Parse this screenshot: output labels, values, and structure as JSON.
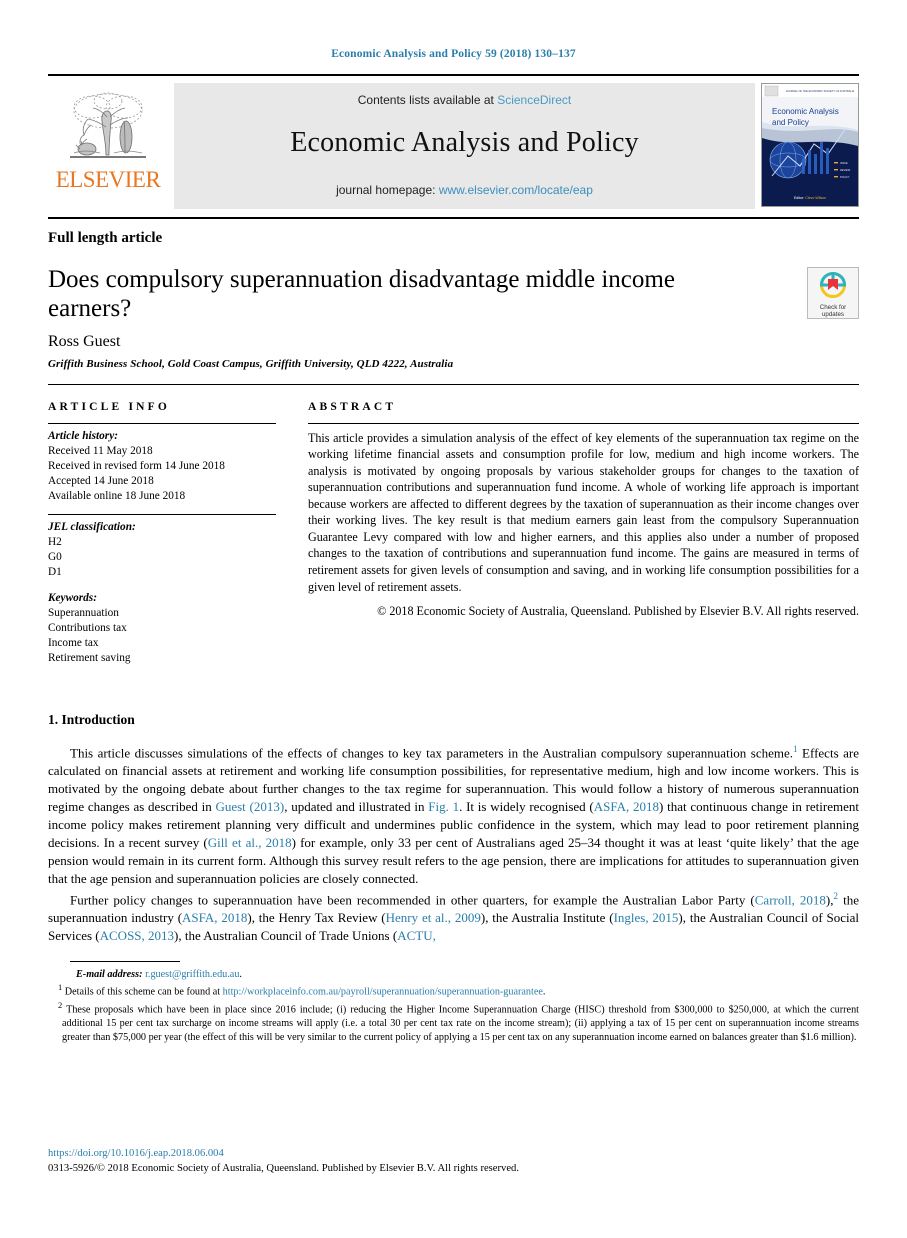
{
  "running_head": "Economic Analysis and Policy 59 (2018) 130–137",
  "masthead": {
    "publisher_name": "ELSEVIER",
    "contents_prefix": "Contents lists available at",
    "contents_link": "ScienceDirect",
    "journal_title": "Economic Analysis and Policy",
    "homepage_prefix": "journal homepage:",
    "homepage_url": "www.elsevier.com/locate/eap",
    "cover_title_line1": "Economic Analysis",
    "cover_title_line2": "and Policy",
    "cover_banner": "JOURNAL OF THE ECONOMIC SOCIETY OF AUSTRALIA (QUEENSLAND)",
    "cover_editor": "Editor: Clevo Wilson"
  },
  "article": {
    "type": "Full length article",
    "title": "Does compulsory superannuation disadvantage middle income earners?",
    "authors": "Ross Guest",
    "affiliation": "Griffith Business School, Gold Coast Campus, Griffith University, QLD 4222, Australia",
    "crossmark_line1": "Check for",
    "crossmark_line2": "updates"
  },
  "article_info": {
    "heading": "ARTICLE INFO",
    "history_label": "Article history:",
    "history": [
      "Received 11 May 2018",
      "Received in revised form 14 June 2018",
      "Accepted 14 June 2018",
      "Available online 18 June 2018"
    ],
    "jel_label": "JEL classification:",
    "jel": [
      "H2",
      "G0",
      "D1"
    ],
    "keywords_label": "Keywords:",
    "keywords": [
      "Superannuation",
      "Contributions tax",
      "Income tax",
      "Retirement saving"
    ]
  },
  "abstract": {
    "heading": "ABSTRACT",
    "text": "This article provides a simulation analysis of the effect of key elements of the superannuation tax regime on the working lifetime financial assets and consumption profile for low, medium and high income workers. The analysis is motivated by ongoing proposals by various stakeholder groups for changes to the taxation of superannuation contributions and superannuation fund income. A whole of working life approach is important because workers are affected to different degrees by the taxation of superannuation as their income changes over their working lives. The key result is that medium earners gain least from the compulsory Superannuation Guarantee Levy compared with low and higher earners, and this applies also under a number of proposed changes to the taxation of contributions and superannuation fund income. The gains are measured in terms of retirement assets for given levels of consumption and saving, and in working life consumption possibilities for a given level of retirement assets.",
    "copyright": "© 2018 Economic Society of Australia, Queensland. Published by Elsevier B.V. All rights reserved."
  },
  "intro": {
    "heading": "1. Introduction",
    "p1_a": "This article discusses simulations of the effects of changes to key tax parameters in the Australian compulsory superannuation scheme.",
    "p1_fn": "1",
    "p1_b": " Effects are calculated on financial assets at retirement and working life consumption possibilities, for representative medium, high and low income workers. This is motivated by the ongoing debate about further changes to the tax regime for superannuation. This would follow a history of numerous superannuation regime changes as described in ",
    "p1_link1": "Guest (2013)",
    "p1_c": ", updated and illustrated in ",
    "p1_link2": "Fig. 1",
    "p1_d": ". It is widely recognised (",
    "p1_link3": "ASFA, 2018",
    "p1_e": ") that continuous change in retirement income policy makes retirement planning very difficult and undermines public confidence in the system, which may lead to poor retirement planning decisions. In a recent survey (",
    "p1_link4": "Gill et al., 2018",
    "p1_f": ") for example, only 33 per cent of Australians aged 25–34 thought it was at least ‘quite likely’ that the age pension would remain in its current form. Although this survey result refers to the age pension, there are implications for attitudes to superannuation given that the age pension and superannuation policies are closely connected.",
    "p2_a": "Further policy changes to superannuation have been recommended in other quarters, for example the Australian Labor Party (",
    "p2_link1": "Carroll, 2018",
    "p2_b": "),",
    "p2_fn": "2",
    "p2_c": " the superannuation industry (",
    "p2_link2": "ASFA, 2018",
    "p2_d": "), the Henry Tax Review (",
    "p2_link3": "Henry et al., 2009",
    "p2_e": "), the Australia Institute (",
    "p2_link4": "Ingles, 2015",
    "p2_f": "), the Australian Council of Social Services (",
    "p2_link5": "ACOSS, 2013",
    "p2_g": "), the Australian Council of Trade Unions (",
    "p2_link6": "ACTU,",
    "p2_h": ""
  },
  "footnotes": {
    "email_label": "E-mail address:",
    "email": "r.guest@griffith.edu.au",
    "email_end": ".",
    "fn1_mark": "1",
    "fn1_a": "Details of this scheme can be found at ",
    "fn1_url": "http://workplaceinfo.com.au/payroll/superannuation/superannuation-guarantee",
    "fn1_b": ".",
    "fn2_mark": "2",
    "fn2": "These proposals which have been in place since 2016 include; (i) reducing the Higher Income Superannuation Charge (HISC) threshold from $300,000 to $250,000, at which the current additional 15 per cent tax surcharge on income streams will apply (i.e. a total 30 per cent tax rate on the income stream); (ii) applying a tax of 15 per cent on superannuation income streams greater than $75,000 per year (the effect of this will be very similar to the current policy of applying a 15 per cent tax on any superannuation income earned on balances greater than $1.6 million)."
  },
  "footer": {
    "doi": "https://doi.org/10.1016/j.eap.2018.06.004",
    "issn": "0313-5926/© 2018 Economic Society of Australia, Queensland. Published by Elsevier B.V. All rights reserved."
  },
  "colors": {
    "link_blue": "#2a7eab",
    "sciencedirect_blue": "#4a9bc4",
    "elsevier_orange": "#E87722"
  }
}
